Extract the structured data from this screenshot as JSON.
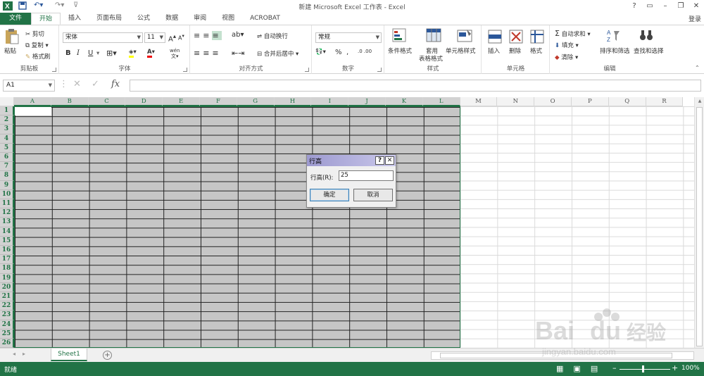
{
  "window": {
    "title": "新建 Microsoft Excel 工作表 - Excel",
    "login": "登录",
    "controls": [
      "?",
      "▭",
      "–",
      "❐",
      "✕"
    ]
  },
  "tabs": [
    {
      "label": "文件",
      "kind": "file"
    },
    {
      "label": "开始",
      "kind": "active"
    },
    {
      "label": "插入"
    },
    {
      "label": "页面布局"
    },
    {
      "label": "公式"
    },
    {
      "label": "数据"
    },
    {
      "label": "审阅"
    },
    {
      "label": "视图"
    },
    {
      "label": "ACROBAT"
    }
  ],
  "ribbon": {
    "clipboard": {
      "label": "剪贴板",
      "paste": "粘贴",
      "cut": "剪切",
      "copy": "复制",
      "format_painter": "格式刷"
    },
    "font": {
      "label": "字体",
      "name": "宋体",
      "size": "11",
      "bold": "B",
      "italic": "I",
      "underline": "U",
      "grow": "A",
      "shrink": "A",
      "phonetic": "wén"
    },
    "alignment": {
      "label": "对齐方式",
      "wrap": "自动换行",
      "merge": "合并后居中"
    },
    "number": {
      "label": "数字",
      "format": "常规",
      "percent": "%",
      "comma": ","
    },
    "styles": {
      "label": "样式",
      "conditional": "条件格式",
      "table1": "套用",
      "table2": "表格格式",
      "cell_styles": "单元格样式"
    },
    "cells": {
      "label": "单元格",
      "insert": "插入",
      "delete": "删除",
      "format": "格式"
    },
    "editing": {
      "label": "编辑",
      "autosum": "自动求和",
      "fill": "填充",
      "clear": "清除",
      "sort": "排序和筛选",
      "find": "查找和选择"
    }
  },
  "formula_bar": {
    "name_box": "A1",
    "fx": "fx",
    "value": ""
  },
  "columns": [
    "A",
    "B",
    "C",
    "D",
    "E",
    "F",
    "G",
    "H",
    "I",
    "J",
    "K",
    "L",
    "M",
    "N",
    "O",
    "P",
    "Q",
    "R"
  ],
  "rows": [
    "1",
    "2",
    "3",
    "4",
    "5",
    "6",
    "7",
    "8",
    "9",
    "10",
    "11",
    "12",
    "13",
    "14",
    "15",
    "16",
    "17",
    "18",
    "19",
    "20",
    "21",
    "22",
    "23",
    "24",
    "25",
    "26"
  ],
  "dialog": {
    "title": "行高",
    "help": "?",
    "close": "✕",
    "field_label": "行高(R):",
    "field_value": "25",
    "ok": "确定",
    "cancel": "取消"
  },
  "sheets": {
    "active": "Sheet1",
    "add": "+"
  },
  "status": {
    "text": "就绪",
    "zoom": "100%"
  },
  "watermark": {
    "text": "Bai du 经验",
    "url": "jingyan.baidu.com"
  },
  "colors": {
    "accent": "#217346",
    "selection_fill": "#c6c6c6",
    "dialog_title_start": "#9d9ad0"
  }
}
